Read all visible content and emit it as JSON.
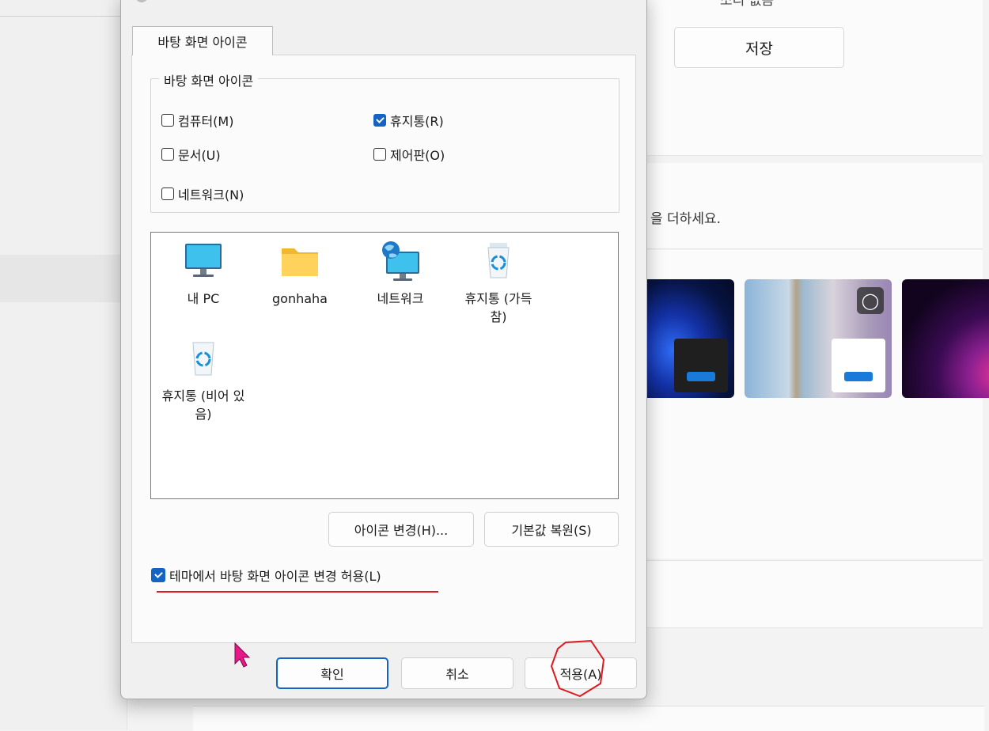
{
  "background": {
    "partial_label": "소리 없음",
    "save_label": "저장",
    "hint_partial": "을 더하세요."
  },
  "dialog": {
    "tab_label": "바탕 화면 아이콘",
    "group_label": "바탕 화면 아이콘",
    "checkboxes": [
      {
        "label": "컴퓨터(M)",
        "checked": false
      },
      {
        "label": "휴지통(R)",
        "checked": true
      },
      {
        "label": "문서(U)",
        "checked": false
      },
      {
        "label": "제어판(O)",
        "checked": false
      },
      {
        "label": "네트워크(N)",
        "checked": false
      }
    ],
    "icons": [
      {
        "name": "my-pc",
        "label": "내 PC",
        "icon": "monitor-icon"
      },
      {
        "name": "gonhaha",
        "label": "gonhaha",
        "icon": "folder-icon"
      },
      {
        "name": "network",
        "label": "네트워크",
        "icon": "network-icon"
      },
      {
        "name": "recycle-full",
        "label": "휴지통 (가득 참)",
        "icon": "recycle-bin-full-icon"
      },
      {
        "name": "recycle-empty",
        "label": "휴지통 (비어 있음)",
        "icon": "recycle-bin-empty-icon"
      }
    ],
    "change_icon_label": "아이콘 변경(H)...",
    "restore_default_label": "기본값 복원(S)",
    "allow_theme_label": "테마에서 바탕 화면 아이콘 변경 허용(L)",
    "allow_theme_checked": true,
    "ok_label": "확인",
    "cancel_label": "취소",
    "apply_label": "적용(A)"
  },
  "colors": {
    "accent": "#1563c2",
    "annotation_red": "#e01820",
    "cursor_magenta": "#e8178a"
  }
}
